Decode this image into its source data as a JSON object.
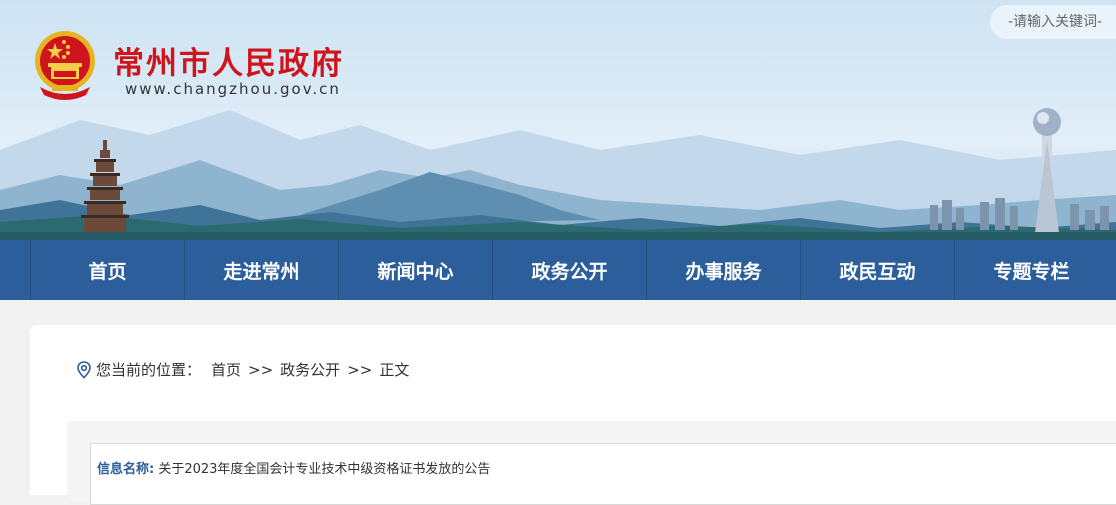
{
  "header": {
    "site_title": "常州市人民政府",
    "site_url": "www.changzhou.gov.cn",
    "search_placeholder": "-请输入关键词-"
  },
  "nav": {
    "items": [
      {
        "label": "首页"
      },
      {
        "label": "走进常州"
      },
      {
        "label": "新闻中心"
      },
      {
        "label": "政务公开"
      },
      {
        "label": "办事服务"
      },
      {
        "label": "政民互动"
      },
      {
        "label": "专题专栏"
      }
    ]
  },
  "breadcrumb": {
    "prefix": "您当前的位置：",
    "items": [
      "首页",
      "政务公开",
      "正文"
    ],
    "separator": ">>"
  },
  "info": {
    "name_label": "信息名称:",
    "name_value": "关于2023年度全国会计专业技术中级资格证书发放的公告"
  },
  "colors": {
    "brand_red": "#d0141b",
    "nav_blue": "#2c5e9c",
    "label_blue": "#2c5e9c"
  }
}
